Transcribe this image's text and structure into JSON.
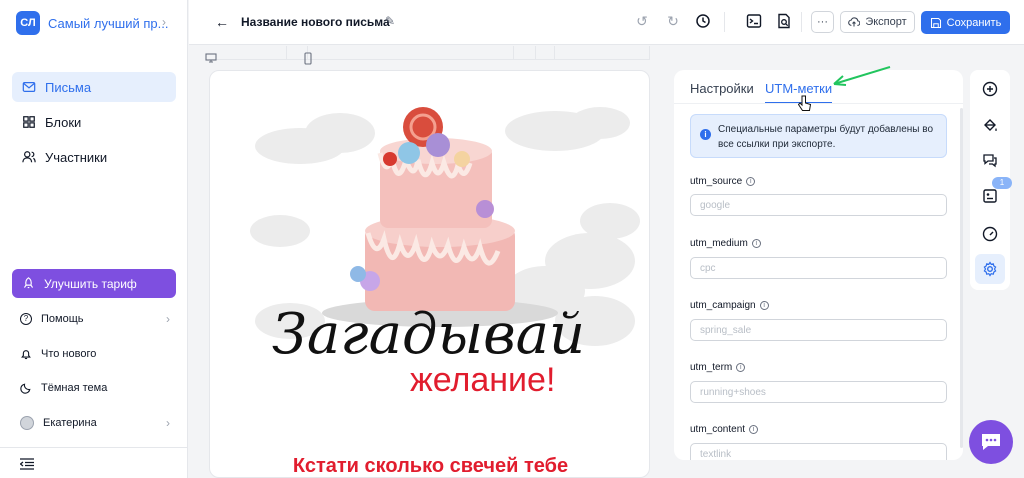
{
  "sidebar": {
    "workspace_badge": "СЛ",
    "workspace_name": "Самый лучший пр...",
    "items": [
      {
        "label": "Письма",
        "icon": "mail-icon",
        "active": true
      },
      {
        "label": "Блоки",
        "icon": "blocks-icon",
        "active": false
      },
      {
        "label": "Участники",
        "icon": "users-icon",
        "active": false
      }
    ],
    "upgrade_label": "Улучшить тариф",
    "help_label": "Помощь",
    "whats_new_label": "Что нового",
    "dark_theme_label": "Тёмная тема",
    "user_name": "Екатерина"
  },
  "topbar": {
    "title": "Название нового письма",
    "more_label": "···",
    "export_label": "Экспорт",
    "save_label": "Сохранить"
  },
  "preview": {
    "headline_script": "Загадывай",
    "headline_accent": "желание!",
    "subheadline": "Кстати сколько свечей тебе"
  },
  "panel": {
    "tabs": [
      {
        "label": "Настройки",
        "active": false
      },
      {
        "label": "UTM-метки",
        "active": true
      }
    ],
    "info_text": "Специальные параметры будут добавлены во все ссылки при экспорте.",
    "fields": [
      {
        "label": "utm_source",
        "placeholder": "google"
      },
      {
        "label": "utm_medium",
        "placeholder": "cpc"
      },
      {
        "label": "utm_campaign",
        "placeholder": "spring_sale"
      },
      {
        "label": "utm_term",
        "placeholder": "running+shoes"
      },
      {
        "label": "utm_content",
        "placeholder": "textlink"
      }
    ]
  },
  "right_toolbar": {
    "badge_count": "1"
  },
  "colors": {
    "primary": "#2f6fec",
    "upgrade": "#7e4fe0",
    "headline_red": "#e11d2e",
    "annotation_arrow": "#22c55e"
  }
}
